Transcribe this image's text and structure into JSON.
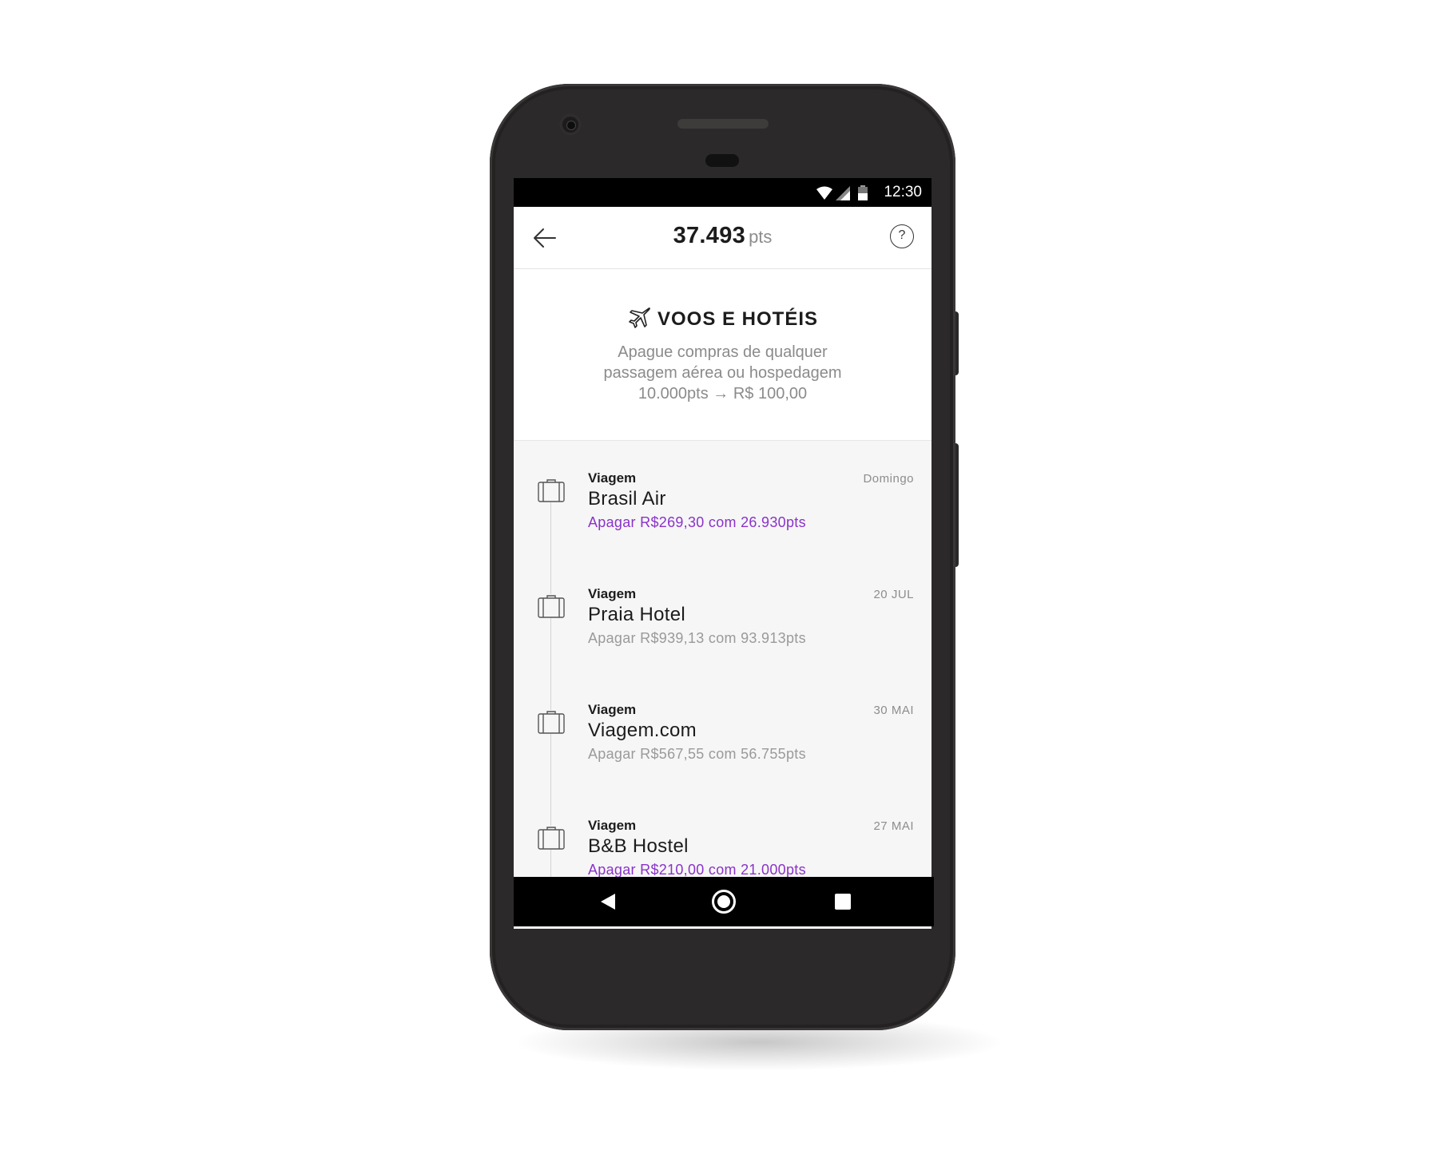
{
  "status_bar": {
    "time": "12:30"
  },
  "app_bar": {
    "points_value": "37.493",
    "points_unit": "pts",
    "help_label": "?"
  },
  "section": {
    "title": "VOOS E HOTÉIS",
    "description_line1": "Apague compras de qualquer",
    "description_line2": "passagem aérea ou hospedagem",
    "description_line3": "10.000pts → R$ 100,00"
  },
  "items": [
    {
      "category": "Viagem",
      "name": "Brasil Air",
      "date": "Domingo",
      "action": "Apagar R$269,30 com 26.930pts",
      "action_enabled": true
    },
    {
      "category": "Viagem",
      "name": "Praia Hotel",
      "date": "20 JUL",
      "action": "Apagar R$939,13 com 93.913pts",
      "action_enabled": false
    },
    {
      "category": "Viagem",
      "name": "Viagem.com",
      "date": "30 MAI",
      "action": "Apagar R$567,55 com 56.755pts",
      "action_enabled": false
    },
    {
      "category": "Viagem",
      "name": "B&B Hostel",
      "date": "27 MAI",
      "action": "Apagar R$210,00 com 21.000pts",
      "action_enabled": true
    }
  ],
  "colors": {
    "accent": "#8a33c9",
    "muted": "#9a9a9a",
    "text": "#1c1c1c",
    "list_bg": "#f6f6f6"
  },
  "icons": {
    "back": "arrow-left-icon",
    "help": "question-circle-icon",
    "section": "airplane-icon",
    "item": "suitcase-icon",
    "nav_back": "triangle-back-icon",
    "nav_home": "circle-home-icon",
    "nav_recent": "square-recents-icon"
  }
}
